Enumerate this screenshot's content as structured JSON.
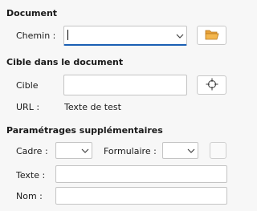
{
  "document": {
    "title": "Document",
    "path_label": "Chemin :",
    "path_value": ""
  },
  "target": {
    "title": "Cible dans le document",
    "target_label": "Cible",
    "target_value": "",
    "url_label": "URL :",
    "url_value": "Texte de test"
  },
  "extra": {
    "title": "Paramétrages supplémentaires",
    "frame_label": "Cadre :",
    "form_label": "Formulaire :",
    "text_label": "Texte :",
    "text_value": "",
    "name_label": "Nom :",
    "name_value": ""
  },
  "colors": {
    "folder": "#e8a23a",
    "focus": "#1a5fb4"
  },
  "icons": {
    "open": "folder-open-icon",
    "target": "crosshair-icon",
    "dropdown": "chevron-down-icon"
  }
}
